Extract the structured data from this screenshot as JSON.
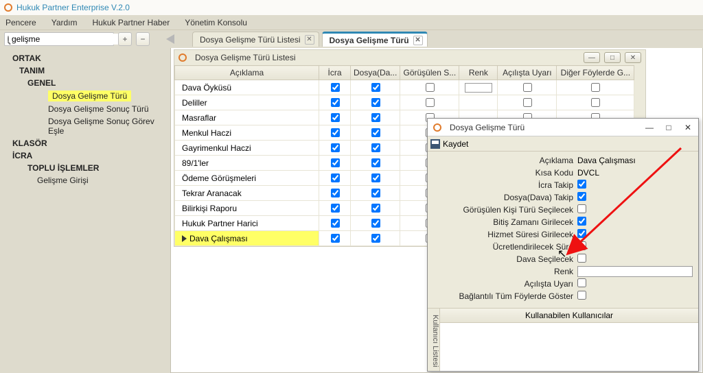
{
  "app": {
    "title": "Hukuk Partner Enterprise V.2.0"
  },
  "menu": {
    "items": [
      "Pencere",
      "Yardım",
      "Hukuk Partner Haber",
      "Yönetim Konsolu"
    ]
  },
  "search": {
    "value": "gelişme"
  },
  "toolbar": {
    "plus": "+",
    "minus": "−"
  },
  "doc_tabs": [
    {
      "label": "Dosya Gelişme Türü Listesi",
      "active": false
    },
    {
      "label": "Dosya Gelişme Türü",
      "active": true
    }
  ],
  "tree": {
    "ortak": "ORTAK",
    "tanim": "TANIM",
    "genel": "GENEL",
    "items": [
      "Dosya Gelişme Türü",
      "Dosya Gelişme Sonuç Türü",
      "Dosya Gelişme Sonuç Görev Eşle"
    ],
    "klasor": "KLASÖR",
    "icra": "İCRA",
    "toplu": "TOPLU İŞLEMLER",
    "gelisme_girisi": "Gelişme Girişi"
  },
  "list_window": {
    "title": "Dosya Gelişme Türü Listesi",
    "columns": [
      "Açıklama",
      "İcra",
      "Dosya(Da...",
      "Görüşülen S...",
      "Renk",
      "Açılışta Uyarı",
      "Diğer Föylerde G..."
    ],
    "rows": [
      {
        "desc": "Dava Öyküsü",
        "c": [
          true,
          true,
          false
        ],
        "renk": true,
        "u": false,
        "d": false
      },
      {
        "desc": "Deliller",
        "c": [
          true,
          true,
          false
        ],
        "renk": false,
        "u": false,
        "d": false
      },
      {
        "desc": "Masraflar",
        "c": [
          true,
          true,
          false
        ],
        "renk": false,
        "u": false,
        "d": false
      },
      {
        "desc": "Menkul Haczi",
        "c": [
          true,
          true,
          false
        ],
        "renk": false,
        "u": false,
        "d": false
      },
      {
        "desc": "Gayrimenkul Haczi",
        "c": [
          true,
          true,
          false
        ],
        "renk": false,
        "u": false,
        "d": false
      },
      {
        "desc": "89/1'ler",
        "c": [
          true,
          true,
          false
        ],
        "renk": false,
        "u": false,
        "d": false
      },
      {
        "desc": "Ödeme Görüşmeleri",
        "c": [
          true,
          true,
          false
        ],
        "renk": false,
        "u": false,
        "d": false
      },
      {
        "desc": "Tekrar Aranacak",
        "c": [
          true,
          true,
          false
        ],
        "renk": false,
        "u": false,
        "d": false
      },
      {
        "desc": "Bilirkişi Raporu",
        "c": [
          true,
          true,
          false
        ],
        "renk": false,
        "u": false,
        "d": false
      },
      {
        "desc": "Hukuk Partner Harici",
        "c": [
          true,
          true,
          false
        ],
        "renk": false,
        "u": false,
        "d": false
      },
      {
        "desc": "Dava Çalışması",
        "c": [
          true,
          true,
          false
        ],
        "renk": false,
        "u": false,
        "d": false,
        "selected": true
      }
    ]
  },
  "detail_window": {
    "title": "Dosya Gelişme Türü",
    "save": "Kaydet",
    "fields": {
      "aciklama_label": "Açıklama",
      "aciklama": "Dava Çalışması",
      "kisa_label": "Kısa Kodu",
      "kisa": "DVCL",
      "icra_label": "İcra Takip",
      "icra": true,
      "dosya_label": "Dosya(Dava) Takip",
      "dosya": true,
      "gorus_label": "Görüşülen Kişi Türü Seçilecek",
      "gorus": false,
      "bitis_label": "Bitiş Zamanı Girilecek",
      "bitis": true,
      "hizmet_label": "Hizmet Süresi Girilecek",
      "hizmet": true,
      "ucret_label": "Ücretlendirilecek Süre",
      "ucret": false,
      "dava_label": "Dava Seçilecek",
      "dava": false,
      "renk_label": "Renk",
      "renk": "",
      "acilis_label": "Açılışta Uyarı",
      "acilis": false,
      "bagl_label": "Bağlantılı Tüm Föylerde Göster",
      "bagl": false
    },
    "users_tab": "Kullanıcı Listesi",
    "users_head": "Kullanabilen Kullanıcılar"
  }
}
